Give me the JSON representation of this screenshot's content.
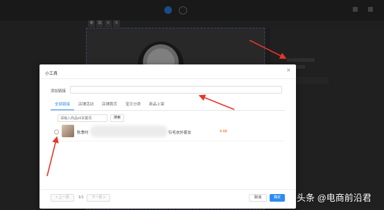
{
  "modal": {
    "title": "小工具",
    "close_icon": "close-icon",
    "link_label": "添加链接",
    "link_value": "",
    "tabs": [
      {
        "label": "全部链接",
        "active": true
      },
      {
        "label": "店铺活动",
        "active": false
      },
      {
        "label": "店铺首页",
        "active": false
      },
      {
        "label": "宝贝分类",
        "active": false
      },
      {
        "label": "新品上架",
        "active": false
      }
    ],
    "search": {
      "placeholder": "请输入商品id/关键词",
      "button_label": "搜索"
    },
    "row": {
      "name_start": "秋季时",
      "name_end": "衍毛衣外套女",
      "price": "¥ 88"
    },
    "pager": {
      "prev": "< 上一页",
      "page": "1/1",
      "next": "下一页 >"
    },
    "cancel_label": "取消",
    "confirm_label": "确定"
  },
  "watermark": "头条 @电商前沿君",
  "colors": {
    "accent": "#2d8cf0",
    "price": "#ff6a00",
    "arrow": "#e8352a"
  }
}
